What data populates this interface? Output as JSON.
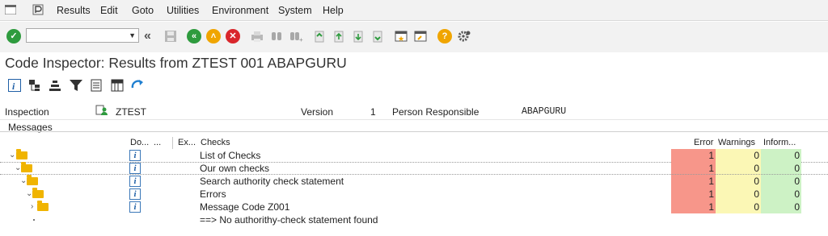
{
  "menu": {
    "items": [
      "Results",
      "Edit",
      "Goto",
      "Utilities",
      "Environment",
      "System",
      "Help"
    ]
  },
  "toolbar": {
    "command_field_value": "",
    "icons": [
      "enter-icon",
      "back-double-arrow-icon",
      "save-icon",
      "back-icon",
      "exit-icon",
      "cancel-icon",
      "print-icon",
      "find-icon",
      "find-next-icon",
      "first-page-icon",
      "previous-page-icon",
      "next-page-icon",
      "last-page-icon",
      "create-session-icon",
      "shortcut-icon",
      "help-icon",
      "customize-layout-icon"
    ]
  },
  "page": {
    "title": "Code Inspector: Results from ZTEST 001 ABAPGURU"
  },
  "app_toolbar": {
    "icons": [
      "details-icon",
      "hierarchy-icon",
      "sort-icon",
      "filter-icon",
      "export-icon",
      "layout-icon",
      "refresh-icon"
    ]
  },
  "header": {
    "inspection_label": "Inspection",
    "inspection_value": "ZTEST",
    "version_label": "Version",
    "version_value": "1",
    "person_label": "Person Responsible",
    "person_value": "ABAPGURU"
  },
  "messages": {
    "label": "Messages"
  },
  "table": {
    "columns": {
      "doc": "Do...",
      "col2": "...",
      "exc": "Ex...",
      "checks": "Checks",
      "error": "Error",
      "warnings": "Warnings",
      "info": "Inform..."
    },
    "rows": [
      {
        "check": "List of Checks",
        "error": "1",
        "warnings": "0",
        "info": "0"
      },
      {
        "check": "Our own checks",
        "error": "1",
        "warnings": "0",
        "info": "0"
      },
      {
        "check": "Search authority check statement",
        "error": "1",
        "warnings": "0",
        "info": "0"
      },
      {
        "check": "Errors",
        "error": "1",
        "warnings": "0",
        "info": "0"
      },
      {
        "check": "Message Code Z001",
        "error": "1",
        "warnings": "0",
        "info": "0"
      },
      {
        "check": "==> No authorithy-check statement found"
      }
    ]
  },
  "colors": {
    "error": "#f7968a",
    "warning": "#fbf7b5",
    "info": "#cdf2c5",
    "folder": "#f0b400",
    "accent_blue": "#1f5fa6"
  }
}
